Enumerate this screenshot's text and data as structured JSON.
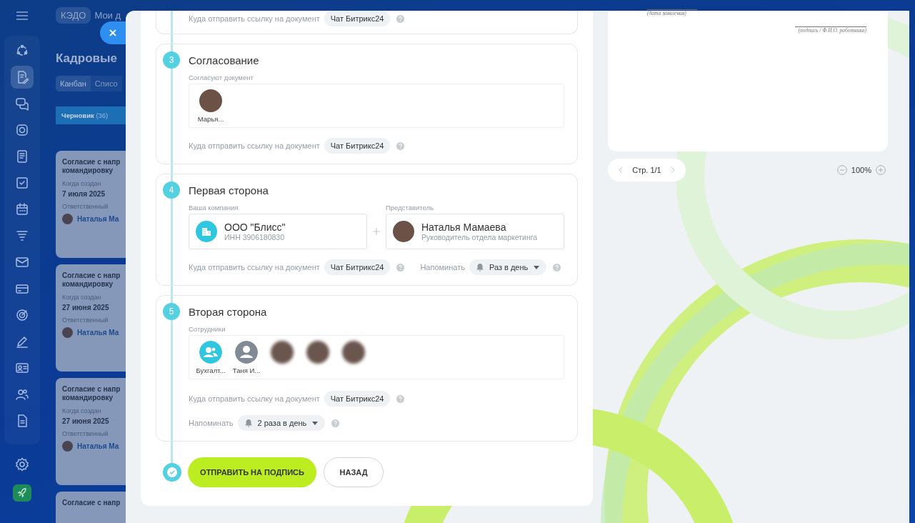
{
  "sidebar": {
    "items": [
      {
        "selected": false
      },
      {
        "selected": true
      },
      {
        "selected": false
      },
      {
        "selected": false
      },
      {
        "selected": false
      },
      {
        "selected": false
      },
      {
        "selected": false
      },
      {
        "selected": false
      },
      {
        "selected": false
      },
      {
        "selected": false
      },
      {
        "selected": false
      },
      {
        "selected": false
      },
      {
        "selected": false
      },
      {
        "selected": false
      },
      {
        "selected": false
      }
    ]
  },
  "header_tabs": [
    {
      "label": "КЭДО",
      "selected": true
    },
    {
      "label": "Мои д",
      "selected": false
    }
  ],
  "page_title": "Кадровые",
  "view_tabs": [
    {
      "label": "Канбан",
      "selected": true
    },
    {
      "label": "Списо",
      "selected": false
    }
  ],
  "column": {
    "title": "Черновик",
    "count": "(36)"
  },
  "cards": [
    {
      "title": [
        "Согласие с напр",
        "командировку"
      ],
      "created_label": "Когда создан",
      "created": "7 июля 2025",
      "responsible_label": "Ответственный",
      "responsible": "Наталья Ма"
    },
    {
      "title": [
        "Согласие с напр",
        "командировку"
      ],
      "created_label": "Когда создан",
      "created": "27 июня 2025",
      "responsible_label": "Ответственный",
      "responsible": "Наталья Ма"
    },
    {
      "title": [
        "Согласие с напр",
        "командировку"
      ],
      "created_label": "Когда создан",
      "created": "27 июня 2025",
      "responsible_label": "Ответственный",
      "responsible": "Наталья Ма"
    },
    {
      "title": [
        "Согласие с напр"
      ]
    }
  ],
  "sections": [
    {
      "kind": "tail",
      "link_label": "Куда отправить ссылку на документ",
      "link_chip": "Чат Битрикс24"
    },
    {
      "kind": "people",
      "number": "3",
      "title": "Согласование",
      "field_label": "Согласуют документ",
      "people": [
        {
          "kind": "photo",
          "name": "Марья..."
        }
      ],
      "link_label": "Куда отправить ссылку на документ",
      "link_chip": "Чат Битрикс24"
    },
    {
      "kind": "parties",
      "number": "4",
      "title": "Первая сторона",
      "company_label": "Ваша компания",
      "company_name": "ООО \"Блисс\"",
      "company_inn": "ИНН 3906180830",
      "rep_label": "Представитель",
      "rep_name": "Наталья Мамаева",
      "rep_position": "Руководитель отдела маркетинга",
      "link_label": "Куда отправить ссылку на документ",
      "link_chip": "Чат Битрикс24",
      "remind_label": "Напоминать",
      "remind_value": "Раз в день"
    },
    {
      "kind": "people",
      "number": "5",
      "title": "Вторая сторона",
      "field_label": "Сотрудники",
      "people": [
        {
          "kind": "group",
          "name": "Бухгалт..."
        },
        {
          "kind": "user",
          "name": "Таня И..."
        },
        {
          "kind": "blurred"
        },
        {
          "kind": "blurred"
        },
        {
          "kind": "blurred"
        }
      ],
      "link_label": "Куда отправить ссылку на документ",
      "link_chip": "Чат Битрикс24",
      "remind_label": "Напоминать",
      "remind_value": "2 раза в день"
    }
  ],
  "actions": {
    "submit": "ОТПРАВИТЬ НА ПОДПИСЬ",
    "back": "НАЗАД"
  },
  "preview": {
    "date_caption": "(дата заявления)",
    "signature_caption": "(подпись / Ф.И.О. работника)",
    "page": "Стр. 1/1",
    "zoom": "100%"
  }
}
